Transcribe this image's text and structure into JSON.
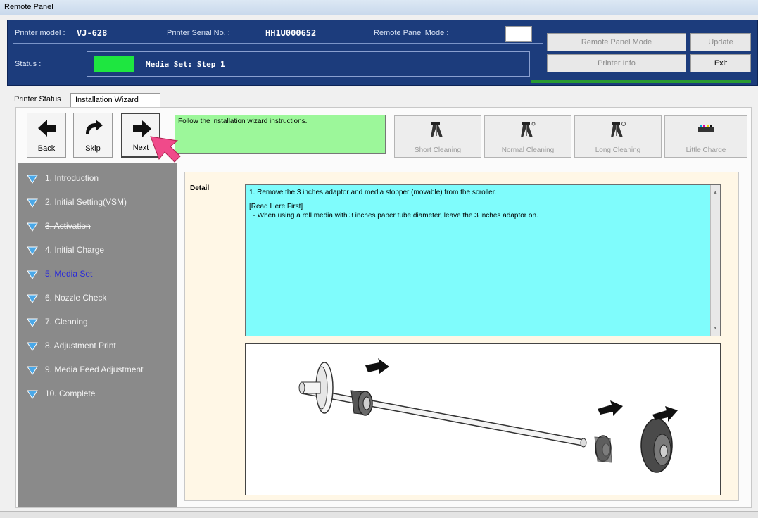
{
  "window": {
    "title": "Remote Panel"
  },
  "header": {
    "printer_model_label": "Printer model :",
    "printer_model_value": "VJ-628",
    "serial_label": "Printer Serial No. :",
    "serial_value": "HH1U000652",
    "panel_mode_label": "Remote Panel Mode :",
    "status_label": "Status :",
    "status_text": "Media Set: Step 1",
    "status_color": "#1ee640",
    "buttons": {
      "remote_panel_mode": "Remote Panel Mode",
      "update": "Update",
      "printer_info": "Printer Info",
      "exit": "Exit"
    }
  },
  "tabs": [
    {
      "label": "Printer Status"
    },
    {
      "label": "Installation Wizard"
    }
  ],
  "nav": {
    "back": "Back",
    "skip": "Skip",
    "next": "Next"
  },
  "instruction": "Follow the installation wizard instructions.",
  "cleaning_buttons": [
    {
      "label": "Short Cleaning",
      "icon": "cleaning-icon"
    },
    {
      "label": "Normal Cleaning",
      "icon": "cleaning-icon"
    },
    {
      "label": "Long Cleaning",
      "icon": "cleaning-icon"
    },
    {
      "label": "Little Charge",
      "icon": "ink-charge-icon"
    }
  ],
  "steps": [
    {
      "label": "1. Introduction",
      "state": "normal"
    },
    {
      "label": "2. Initial Setting(VSM)",
      "state": "normal"
    },
    {
      "label": "3. Activation",
      "state": "done"
    },
    {
      "label": "4. Initial Charge",
      "state": "normal"
    },
    {
      "label": "5. Media Set",
      "state": "current"
    },
    {
      "label": "6. Nozzle Check",
      "state": "normal"
    },
    {
      "label": "7. Cleaning",
      "state": "normal"
    },
    {
      "label": "8. Adjustment Print",
      "state": "normal"
    },
    {
      "label": "9. Media Feed Adjustment",
      "state": "normal"
    },
    {
      "label": "10. Complete",
      "state": "normal"
    }
  ],
  "detail": {
    "label": "Detail",
    "line1": "1. Remove the 3 inches adaptor and media stopper (movable) from the scroller.",
    "line2": "[Read Here First]",
    "line3": "  - When using a roll media with 3 inches paper tube diameter, leave the 3 inches adaptor on.",
    "illustration": "scroller-with-adaptor-and-media-stopper"
  },
  "colors": {
    "header_bg": "#1c3c7c",
    "instruction_bg": "#9cf79a",
    "detail_text_bg": "#7ffcfc",
    "sidebar_bg": "#8a8a8a",
    "current_step": "#2a2ad8"
  }
}
